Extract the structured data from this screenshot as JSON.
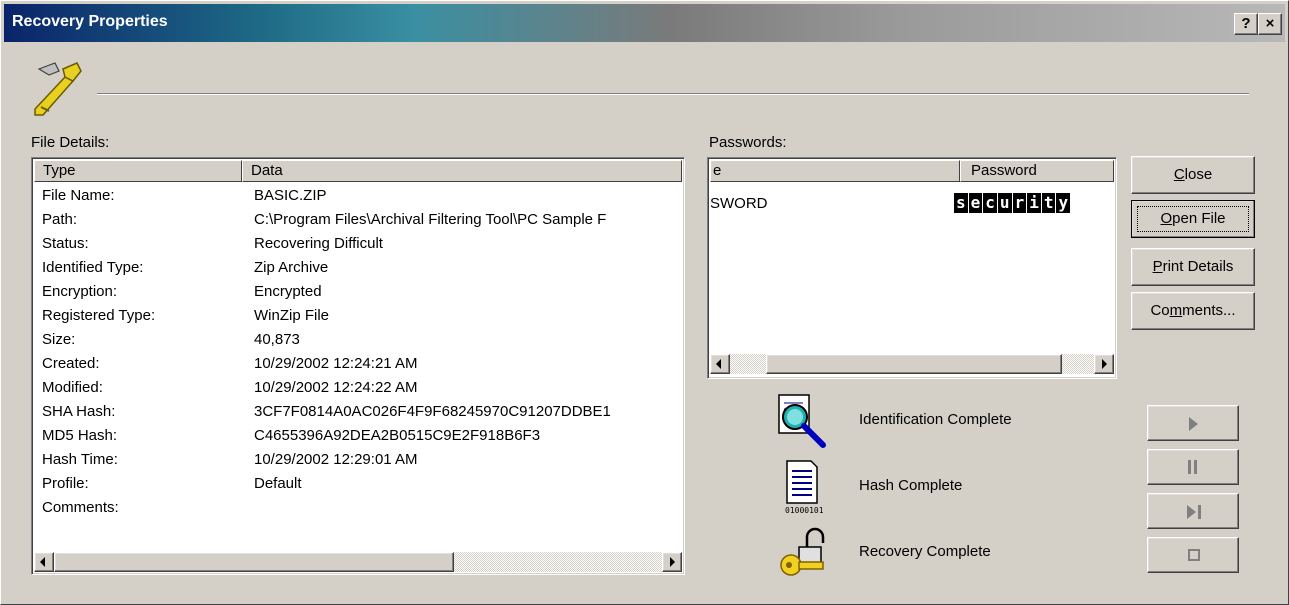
{
  "window": {
    "title": "Recovery Properties",
    "help_btn": "?",
    "close_btn": "×"
  },
  "file_details": {
    "label": "File Details:",
    "columns": [
      "Type",
      "Data"
    ],
    "rows": [
      [
        "File Name:",
        "BASIC.ZIP"
      ],
      [
        "Path:",
        "C:\\Program Files\\Archival Filtering Tool\\PC Sample F"
      ],
      [
        "Status:",
        "Recovering Difficult"
      ],
      [
        "Identified Type:",
        "Zip Archive"
      ],
      [
        "Encryption:",
        "Encrypted"
      ],
      [
        "Registered Type:",
        "WinZip File"
      ],
      [
        "Size:",
        "40,873"
      ],
      [
        "Created:",
        "10/29/2002 12:24:21 AM"
      ],
      [
        "Modified:",
        "10/29/2002 12:24:22 AM"
      ],
      [
        "SHA Hash:",
        "3CF7F0814A0AC026F4F9F68245970C91207DDBE1"
      ],
      [
        "MD5 Hash:",
        "C4655396A92DEA2B0515C9E2F918B6F3"
      ],
      [
        "Hash Time:",
        "10/29/2002 12:29:01 AM"
      ],
      [
        "Profile:",
        "Default"
      ],
      [
        "Comments:",
        ""
      ]
    ]
  },
  "passwords": {
    "label": "Passwords:",
    "columns": [
      "e",
      "Password"
    ],
    "rows": [
      [
        "SWORD",
        "security"
      ]
    ]
  },
  "buttons": {
    "close": "Close",
    "open_file": "Open File",
    "print_details": "Print Details",
    "comments": "Comments..."
  },
  "status": {
    "identification": "Identification Complete",
    "hash": "Hash Complete",
    "recovery": "Recovery Complete"
  },
  "icons": {
    "header": "key-icon",
    "identification": "magnifier-document-icon",
    "hash": "hash-document-icon",
    "recovery": "padlock-key-icon"
  }
}
